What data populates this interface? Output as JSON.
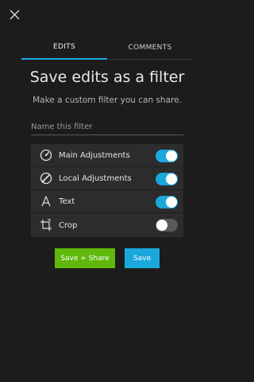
{
  "header": {
    "close_icon": "close-icon"
  },
  "tabs": [
    {
      "label": "EDITS",
      "active": true
    },
    {
      "label": "COMMENTS",
      "active": false
    }
  ],
  "main": {
    "title": "Save edits as a filter",
    "subtitle": "Make a custom filter you can share.",
    "name_field": {
      "placeholder": "Name this filter",
      "value": ""
    }
  },
  "options": [
    {
      "label": "Main Adjustments",
      "icon": "dial-icon",
      "enabled": true
    },
    {
      "label": "Local Adjustments",
      "icon": "brush-icon",
      "enabled": true
    },
    {
      "label": "Text",
      "icon": "text-icon",
      "enabled": true
    },
    {
      "label": "Crop",
      "icon": "crop-icon",
      "enabled": false
    }
  ],
  "actions": {
    "save_share_label": "Save + Share",
    "save_label": "Save"
  },
  "colors": {
    "accent": "#1aa8dc",
    "share_green": "#5fb80b",
    "background": "#1c1c1c",
    "panel": "#2c2c2c"
  }
}
